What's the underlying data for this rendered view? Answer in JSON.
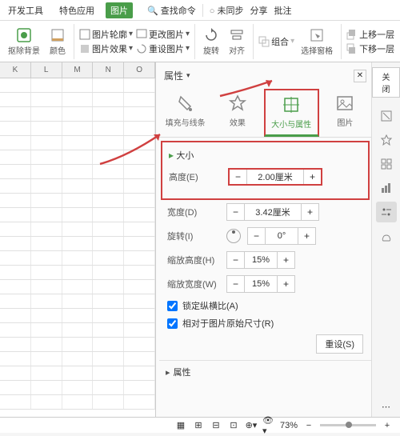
{
  "topbar": {
    "tabs": [
      "开发工具",
      "特色应用",
      "图片"
    ],
    "search": "查找命令",
    "sync": "未同步",
    "share": "分享",
    "annotate": "批注"
  },
  "ribbon": {
    "removeBg": "抠除背景",
    "color": "颜色",
    "outline": "图片轮廓",
    "changePic": "更改图片",
    "effect": "图片效果",
    "resetPic": "重设图片",
    "rotate": "旋转",
    "align": "对齐",
    "group": "组合",
    "selectPane": "选择窗格",
    "up": "上移一层",
    "down": "下移一层"
  },
  "cols": [
    "K",
    "L",
    "M",
    "N",
    "O"
  ],
  "panel": {
    "title": "属性",
    "close": "关闭",
    "tabs": {
      "fill": "填充与线条",
      "effect": "效果",
      "size": "大小与属性",
      "pic": "图片"
    },
    "size": {
      "title": "大小",
      "height": {
        "label": "高度(E)",
        "value": "2.00厘米"
      },
      "width": {
        "label": "宽度(D)",
        "value": "3.42厘米"
      },
      "rotate": {
        "label": "旋转(I)",
        "value": "0°"
      },
      "scaleH": {
        "label": "缩放高度(H)",
        "value": "15%"
      },
      "scaleW": {
        "label": "缩放宽度(W)",
        "value": "15%"
      },
      "lock": "锁定纵横比(A)",
      "relative": "相对于图片原始尺寸(R)",
      "reset": "重设(S)"
    },
    "propsSection": "属性"
  },
  "status": {
    "zoom": "73%"
  }
}
